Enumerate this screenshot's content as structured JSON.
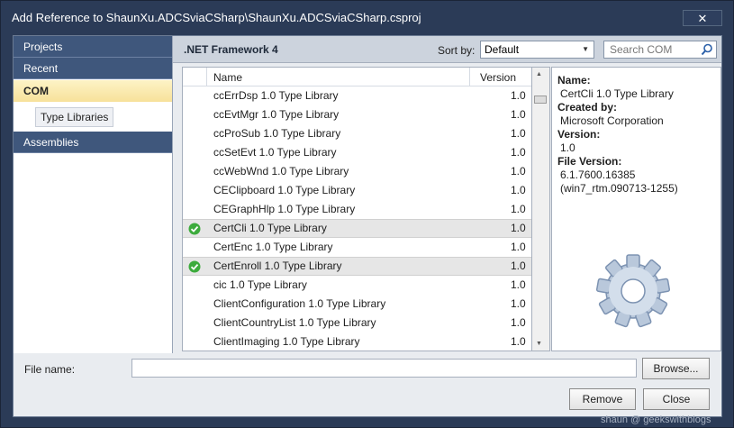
{
  "window": {
    "title": "Add Reference to ShaunXu.ADCSviaCSharp\\ShaunXu.ADCSviaCSharp.csproj",
    "close_icon": "close-x-icon"
  },
  "nav": {
    "projects": "Projects",
    "recent": "Recent",
    "com": "COM",
    "type_libraries": "Type Libraries",
    "assemblies": "Assemblies"
  },
  "header": {
    "framework": ".NET Framework 4",
    "sort_by_label": "Sort by:",
    "sort_value": "Default",
    "search_placeholder": "Search COM"
  },
  "list": {
    "col_name": "Name",
    "col_version": "Version",
    "rows": [
      {
        "name": "ccErrDsp 1.0 Type Library",
        "version": "1.0",
        "checked": false,
        "selected": false
      },
      {
        "name": "ccEvtMgr 1.0 Type Library",
        "version": "1.0",
        "checked": false,
        "selected": false
      },
      {
        "name": "ccProSub 1.0 Type Library",
        "version": "1.0",
        "checked": false,
        "selected": false
      },
      {
        "name": "ccSetEvt 1.0 Type Library",
        "version": "1.0",
        "checked": false,
        "selected": false
      },
      {
        "name": "ccWebWnd 1.0 Type Library",
        "version": "1.0",
        "checked": false,
        "selected": false
      },
      {
        "name": "CEClipboard 1.0 Type Library",
        "version": "1.0",
        "checked": false,
        "selected": false
      },
      {
        "name": "CEGraphHlp 1.0 Type Library",
        "version": "1.0",
        "checked": false,
        "selected": false
      },
      {
        "name": "CertCli 1.0 Type Library",
        "version": "1.0",
        "checked": true,
        "selected": true
      },
      {
        "name": "CertEnc 1.0 Type Library",
        "version": "1.0",
        "checked": false,
        "selected": false
      },
      {
        "name": "CertEnroll 1.0 Type Library",
        "version": "1.0",
        "checked": true,
        "selected": true
      },
      {
        "name": "cic 1.0 Type Library",
        "version": "1.0",
        "checked": false,
        "selected": false
      },
      {
        "name": "ClientConfiguration 1.0 Type Library",
        "version": "1.0",
        "checked": false,
        "selected": false
      },
      {
        "name": "ClientCountryList 1.0 Type Library",
        "version": "1.0",
        "checked": false,
        "selected": false
      },
      {
        "name": "ClientImaging 1.0 Type Library",
        "version": "1.0",
        "checked": false,
        "selected": false
      }
    ]
  },
  "details": {
    "name_label": "Name:",
    "name_value": "CertCli 1.0 Type Library",
    "created_label": "Created by:",
    "created_value": "Microsoft Corporation",
    "version_label": "Version:",
    "version_value": "1.0",
    "file_version_label": "File Version:",
    "file_version_value": "6.1.7600.16385",
    "file_version_build": "(win7_rtm.090713-1255)",
    "image_icon": "gear-icon"
  },
  "footer": {
    "file_name_label": "File name:",
    "file_name_value": "",
    "browse_label": "Browse...",
    "remove_label": "Remove",
    "close_label": "Close"
  },
  "watermark": "shaun @ geekswithblogs",
  "colors": {
    "chrome": "#2b3b57",
    "nav_dark": "#3f577c",
    "nav_selected": "#f7e19a",
    "check_green": "#3cab3c"
  }
}
